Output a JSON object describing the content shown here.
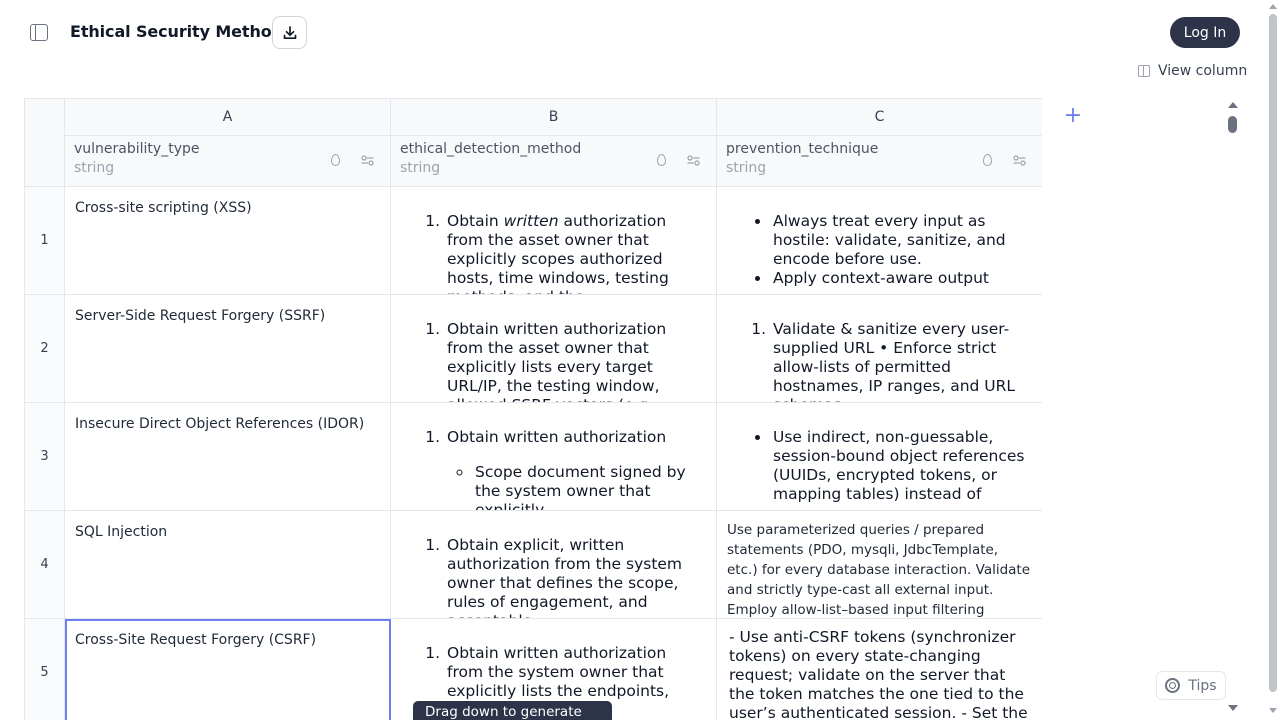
{
  "header": {
    "title": "Ethical Security Methods",
    "download_icon": "download-icon",
    "sidebar_icon": "sidebar-toggle-icon",
    "login_label": "Log In",
    "view_column_label": "View column"
  },
  "columns": [
    {
      "letter": "A",
      "name": "vulnerability_type",
      "type": "string"
    },
    {
      "letter": "B",
      "name": "ethical_detection_method",
      "type": "string"
    },
    {
      "letter": "C",
      "name": "prevention_technique",
      "type": "string"
    }
  ],
  "add_column_label": "+",
  "rows": [
    {
      "num": "1",
      "a": "Cross-site scripting (XSS)",
      "b_pre": "Obtain ",
      "b_em": "written",
      "b_post": " authorization from the asset owner that explicitly scopes authorized hosts, time windows, testing methods, and the",
      "c_bullets": [
        "Always treat every input as hostile: validate, sanitize, and encode before use.",
        "Apply context-aware output"
      ]
    },
    {
      "num": "2",
      "a": "Server-Side Request Forgery (SSRF)",
      "b": "Obtain written authorization from the asset owner that explicitly lists every target URL/IP, the testing window, allowed SSRF vectors (e.g.,",
      "c": "Validate & sanitize every user-supplied URL • Enforce strict allow-lists of permitted hostnames, IP ranges, and URL schemas"
    },
    {
      "num": "3",
      "a": "Insecure Direct Object References (IDOR)",
      "b": "Obtain written authorization",
      "b_sub": "Scope document signed by the system owner that explicitly",
      "c": "Use indirect, non-guessable, session-bound object references (UUIDs, encrypted tokens, or mapping tables) instead of"
    },
    {
      "num": "4",
      "a": "SQL Injection",
      "b": "Obtain explicit, written authorization from the system owner that defines the scope, rules of engagement, and acceptable",
      "c": "Use parameterized queries / prepared statements (PDO, mysqli, JdbcTemplate, etc.) for every database interaction. Validate and strictly type-cast all external input. Employ allow-list–based input filtering (accept only"
    },
    {
      "num": "5",
      "a": "Cross-Site Request Forgery (CSRF)",
      "b": "Obtain written authorization from the system owner that explicitly lists the endpoints, time window,",
      "c": "- Use anti-CSRF tokens (synchronizer tokens) on every state-changing request; validate on the server that the token matches the one tied to the user’s authenticated session. - Set the"
    }
  ],
  "tooltip": "Drag down to generate cells",
  "tips_label": "Tips"
}
